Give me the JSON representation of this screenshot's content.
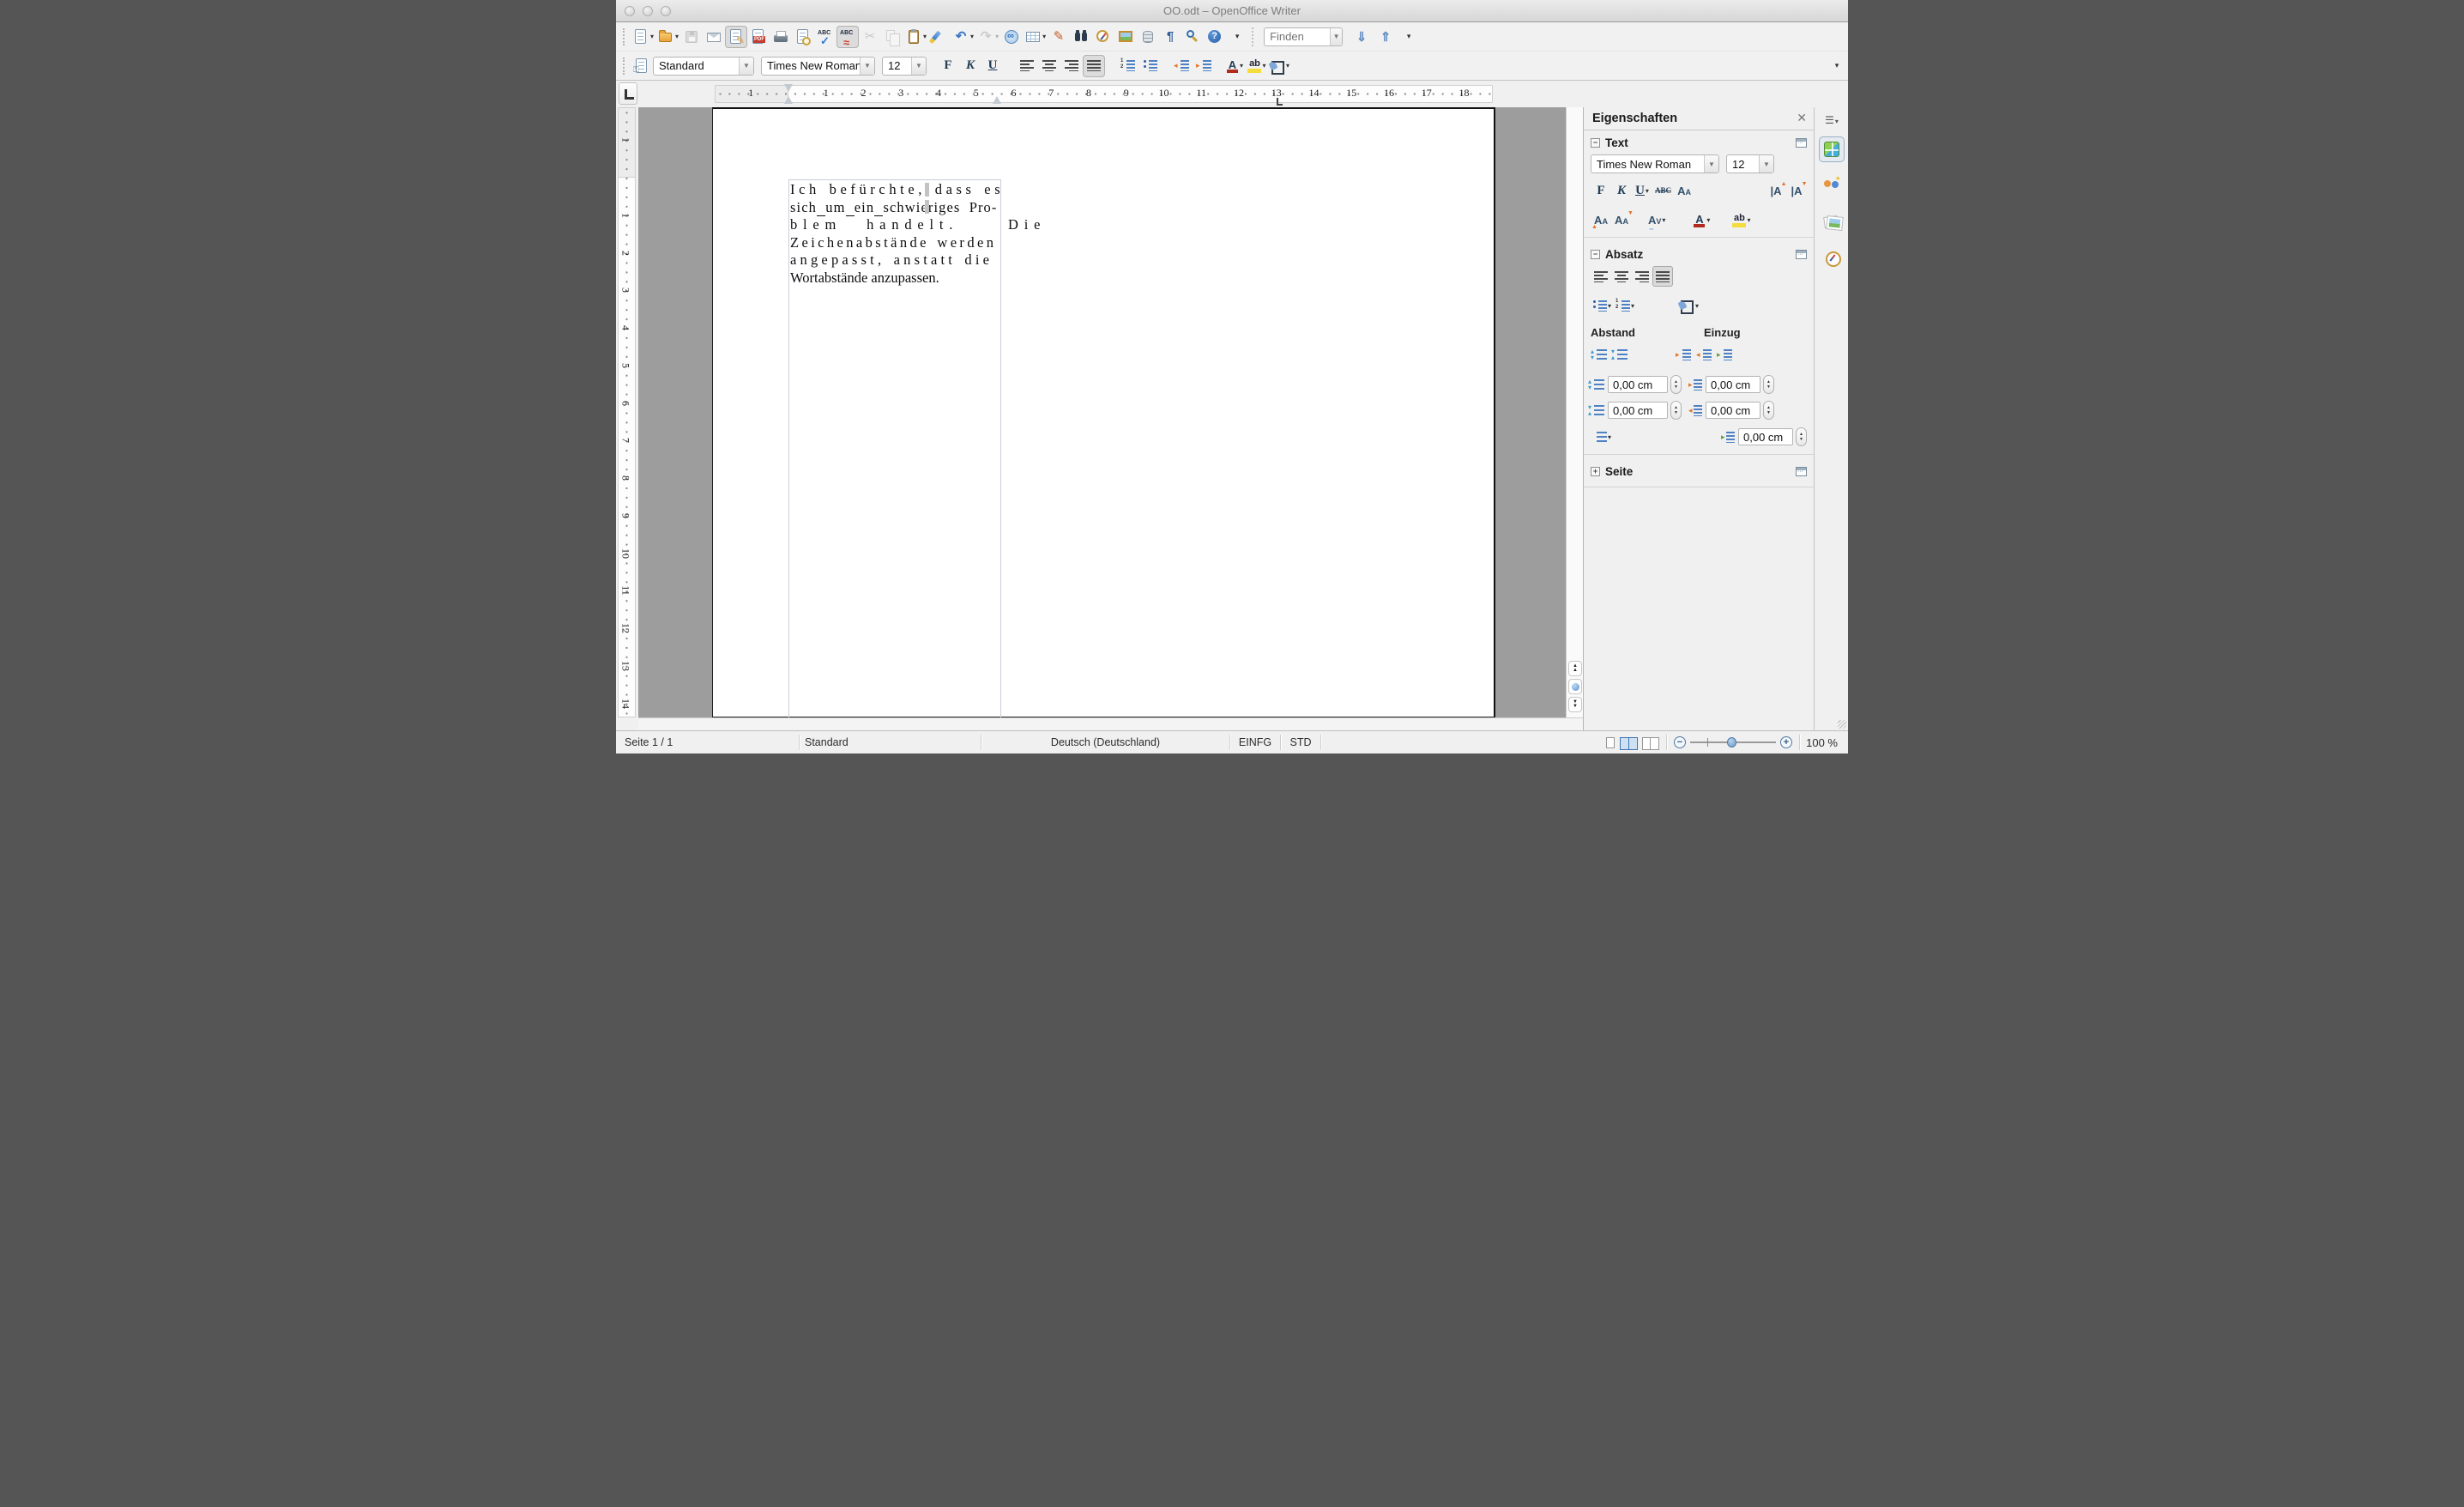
{
  "window": {
    "title": "OO.odt – OpenOffice Writer"
  },
  "toolbar_main": {
    "items": [
      {
        "name": "new-document",
        "dropdown": true
      },
      {
        "name": "open",
        "dropdown": true
      },
      {
        "name": "save",
        "disabled": true
      },
      {
        "name": "mail-document"
      },
      {
        "name": "edit-mode",
        "active": true
      },
      {
        "name": "export-pdf"
      },
      {
        "name": "print"
      },
      {
        "name": "page-preview"
      },
      {
        "name": "spellcheck"
      },
      {
        "name": "auto-spellcheck",
        "active": true
      },
      {
        "name": "cut",
        "disabled": true
      },
      {
        "name": "copy",
        "disabled": true
      },
      {
        "name": "paste",
        "dropdown": true
      },
      {
        "name": "format-paintbrush"
      },
      {
        "name": "undo",
        "dropdown": true
      },
      {
        "name": "redo",
        "disabled": true,
        "dropdown": true
      },
      {
        "name": "hyperlink"
      },
      {
        "name": "table",
        "dropdown": true
      },
      {
        "name": "draw-functions"
      },
      {
        "name": "find-replace"
      },
      {
        "name": "navigator"
      },
      {
        "name": "gallery"
      },
      {
        "name": "data-sources"
      },
      {
        "name": "formatting-marks"
      },
      {
        "name": "zoom"
      },
      {
        "name": "help"
      }
    ],
    "find_placeholder": "Finden"
  },
  "toolbar_format": {
    "paragraph_style": "Standard",
    "font_name": "Times New Roman",
    "font_size": "12",
    "bold_label": "F",
    "italic_label": "K",
    "underline_label": "U"
  },
  "ruler": {
    "h_margin_number": "1",
    "h_numbers": [
      "1",
      "2",
      "3",
      "4",
      "5",
      "6",
      "7",
      "8",
      "9",
      "10",
      "11",
      "12",
      "13",
      "14",
      "15",
      "16",
      "17",
      "18"
    ],
    "h_zero": 175,
    "h_step": 43.75,
    "v_margin_number": "1",
    "v_numbers": [
      "1",
      "2",
      "3",
      "4",
      "5",
      "6",
      "7",
      "8",
      "9",
      "10",
      "11",
      "12",
      "13",
      "14"
    ],
    "v_zero": 82,
    "v_step": 43.75
  },
  "document": {
    "lines": [
      {
        "ls": 4.6,
        "ws": 2,
        "segments": [
          {
            "t": "Ich befürchte, dass es"
          }
        ]
      },
      {
        "ls": 1.1,
        "ws": 5,
        "segments": [
          {
            "t": "sich"
          },
          {
            "t": " ",
            "u": true
          },
          {
            "t": "um"
          },
          {
            "t": " ",
            "u": true
          },
          {
            "t": "ein"
          },
          {
            "t": " ",
            "u": true
          },
          {
            "t": "schwieriges"
          },
          {
            "t": " "
          },
          {
            "t": "Pro-"
          }
        ]
      },
      {
        "ls": 6.8,
        "ws": 18,
        "segments": [
          {
            "t": "blem handelt.  Die"
          }
        ]
      },
      {
        "ls": 3.4,
        "ws": 2,
        "segments": [
          {
            "t": "Zeichenabstände werden"
          }
        ]
      },
      {
        "ls": 4.2,
        "ws": 2,
        "segments": [
          {
            "t": "angepasst, anstatt die"
          }
        ]
      },
      {
        "ls": 0,
        "ws": 0,
        "segments": [
          {
            "t": "Wortabstände anzupassen."
          }
        ]
      }
    ]
  },
  "sidebar": {
    "title": "Eigenschaften",
    "close_label": "✕",
    "rail": [
      {
        "name": "properties-deck",
        "active": true
      },
      {
        "name": "styles-deck"
      },
      {
        "name": "gallery-deck"
      },
      {
        "name": "navigator-deck"
      }
    ],
    "sections": {
      "text": {
        "label": "Text",
        "collapse": "−",
        "font_name": "Times New Roman",
        "font_size": "12",
        "bold_label": "F",
        "italic_label": "K",
        "underline_label": "U",
        "strikethrough_label": "ABC",
        "case_label": "A",
        "fontcolor_label": "A",
        "highlight_label": "ab",
        "supsub_label": "A"
      },
      "paragraph": {
        "label": "Absatz",
        "collapse": "−",
        "spacing_label": "Abstand",
        "indent_label": "Einzug",
        "above_value": "0,00 cm",
        "below_value": "0,00 cm",
        "before_value": "0,00 cm",
        "after_value": "0,00 cm",
        "firstline_value": "0,00 cm"
      },
      "page": {
        "label": "Seite",
        "collapse": "+"
      }
    }
  },
  "statusbar": {
    "page": "Seite 1 / 1",
    "style": "Standard",
    "language": "Deutsch (Deutschland)",
    "insert_mode": "EINFG",
    "selection_mode": "STD",
    "zoom_level": "100 %"
  }
}
